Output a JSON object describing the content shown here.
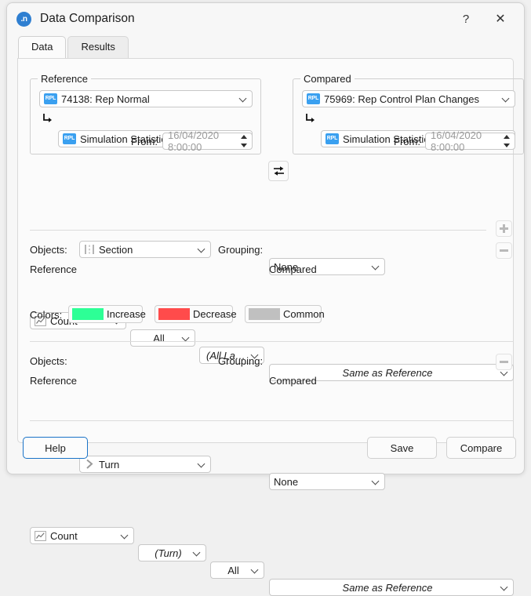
{
  "window": {
    "title": "Data Comparison",
    "app_icon": ".n",
    "help_icon": "?",
    "close_icon": "✕"
  },
  "tabs": [
    {
      "label": "Data",
      "active": true
    },
    {
      "label": "Results",
      "active": false
    }
  ],
  "reference_group": {
    "legend": "Reference",
    "badge": "RPL",
    "replication": "74138: Rep Normal",
    "dataset": "Simulation Statistics",
    "from_label": "From:",
    "from_value": "16/04/2020 8:00:00"
  },
  "compared_group": {
    "legend": "Compared",
    "badge": "RPL",
    "replication": "75969: Rep Control Plan Changes",
    "dataset": "Simulation Statistics",
    "from_label": "From:",
    "from_value": "16/04/2020 8:00:00"
  },
  "swap_button": {
    "name": "swap-reference-compared"
  },
  "add_button": {
    "glyph": "+"
  },
  "sections": [
    {
      "objects_label": "Objects:",
      "objects_value": "Section",
      "objects_icon": "section-icon",
      "grouping_label": "Grouping:",
      "grouping_value": "None",
      "remove_glyph": "−",
      "reference_label": "Reference",
      "compared_label": "Compared",
      "ref_attribute": "Count",
      "ref_attribute_icon": "chart-icon",
      "ref_aggregation": "All",
      "ref_lanes": "(All Lanes)",
      "compared_value": "Same as Reference",
      "colors_label": "Colors:",
      "colors": [
        {
          "label": "Increase",
          "hex": "#2DFF96"
        },
        {
          "label": "Decrease",
          "hex": "#FF4B4B"
        },
        {
          "label": "Common",
          "hex": "#C0C0C0"
        }
      ]
    },
    {
      "objects_label": "Objects:",
      "objects_value": "Turn",
      "objects_icon": "turn-icon",
      "grouping_label": "Grouping:",
      "grouping_value": "None",
      "remove_glyph": "−",
      "reference_label": "Reference",
      "compared_label": "Compared",
      "ref_attribute": "Count",
      "ref_attribute_icon": "chart-icon",
      "ref_aggregation": "(Turn)",
      "ref_lanes": "All",
      "compared_value": "Same as Reference"
    }
  ],
  "footer": {
    "help": "Help",
    "save": "Save",
    "compare": "Compare"
  }
}
